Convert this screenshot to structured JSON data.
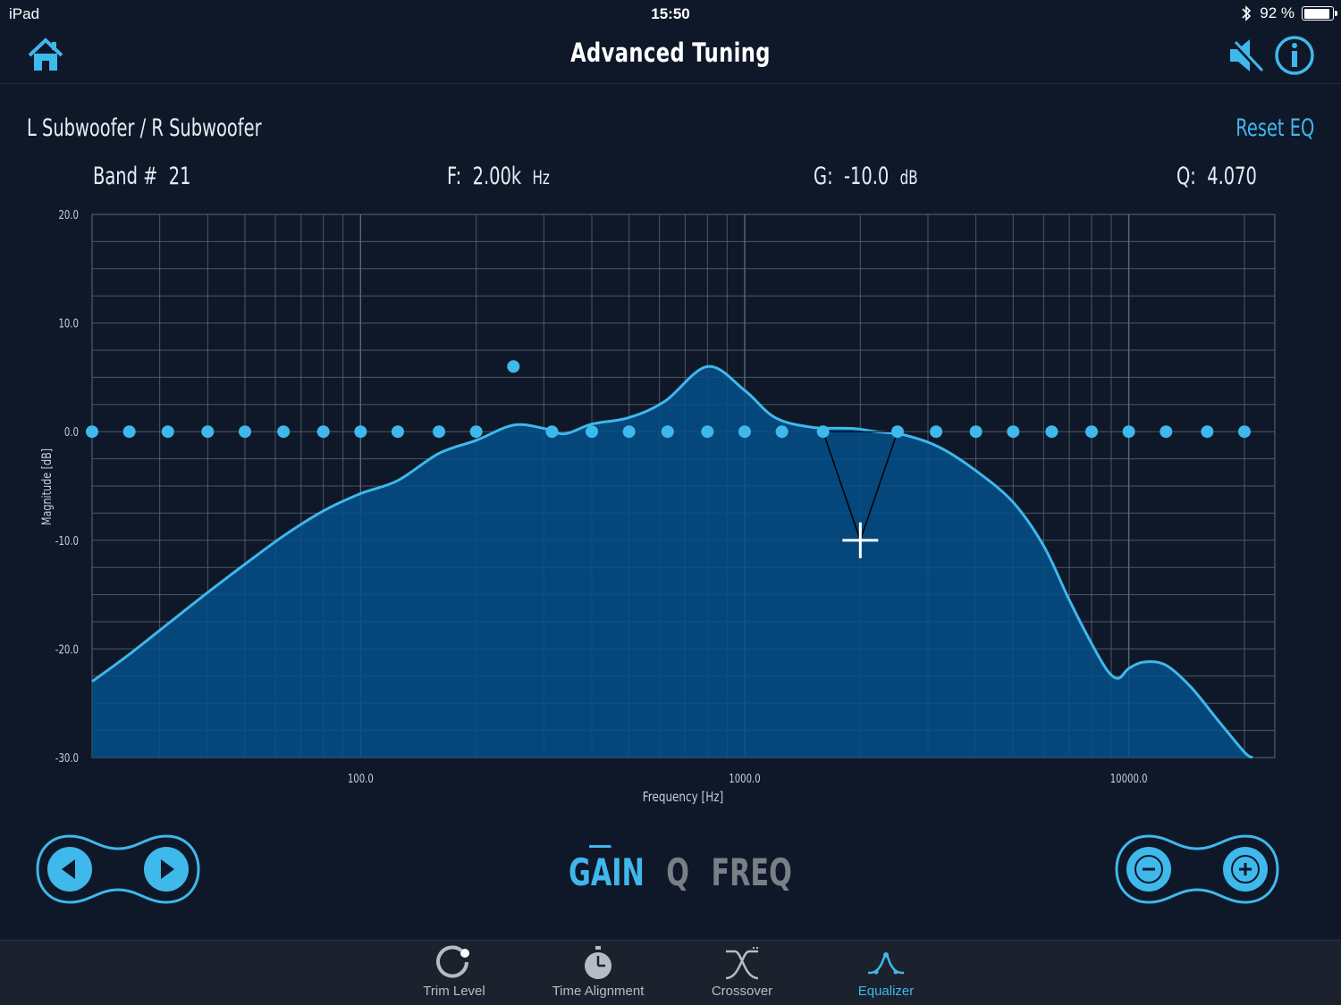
{
  "status": {
    "device": "iPad",
    "time": "15:50",
    "battery": "92 %",
    "battery_level": 0.92
  },
  "nav": {
    "title": "Advanced Tuning",
    "home_icon": "home-icon",
    "speaker_icon": "speaker-mute-icon",
    "info_icon": "info-icon"
  },
  "channel": {
    "label": "L Subwoofer / R Subwoofer",
    "reset_label": "Reset EQ"
  },
  "params": {
    "band_label": "Band #",
    "band_value": "21",
    "freq_label": "F:",
    "freq_value": "2.00k",
    "freq_unit": "Hz",
    "gain_label": "G:",
    "gain_value": "-10.0",
    "gain_unit": "dB",
    "q_label": "Q:",
    "q_value": "4.070"
  },
  "chart_data": {
    "type": "area",
    "xlabel": "Frequency [Hz]",
    "ylabel": "Magnitude [dB]",
    "xscale": "log",
    "xlim": [
      20,
      24000
    ],
    "ylim": [
      -30,
      20
    ],
    "y_ticks": [
      "20.0",
      "10.0",
      "0.0",
      "-10.0",
      "-20.0",
      "-30.0"
    ],
    "y_tick_values": [
      20,
      10,
      0,
      -10,
      -20,
      -30
    ],
    "x_ticks": [
      "100.0",
      "1000.0",
      "10000.0"
    ],
    "x_tick_values": [
      100,
      1000,
      10000
    ],
    "grid": true,
    "response_curve": [
      [
        20,
        -23
      ],
      [
        25,
        -20.5
      ],
      [
        32,
        -17.5
      ],
      [
        40,
        -14.8
      ],
      [
        50,
        -12.2
      ],
      [
        63,
        -9.6
      ],
      [
        80,
        -7.3
      ],
      [
        100,
        -5.7
      ],
      [
        125,
        -4.5
      ],
      [
        160,
        -2.0
      ],
      [
        200,
        -0.8
      ],
      [
        250,
        0.6
      ],
      [
        300,
        0.3
      ],
      [
        340,
        -0.2
      ],
      [
        400,
        0.7
      ],
      [
        500,
        1.3
      ],
      [
        620,
        2.8
      ],
      [
        800,
        6.0
      ],
      [
        1000,
        3.8
      ],
      [
        1200,
        1.3
      ],
      [
        1500,
        0.4
      ],
      [
        1900,
        0.3
      ],
      [
        2200,
        0.0
      ],
      [
        2600,
        -0.3
      ],
      [
        3200,
        -1.4
      ],
      [
        4000,
        -3.6
      ],
      [
        5000,
        -6.5
      ],
      [
        6000,
        -10.5
      ],
      [
        7000,
        -15.5
      ],
      [
        8000,
        -19.5
      ],
      [
        8800,
        -22.0
      ],
      [
        9400,
        -22.7
      ],
      [
        10000,
        -21.8
      ],
      [
        11000,
        -21.2
      ],
      [
        12500,
        -21.5
      ],
      [
        14500,
        -23.5
      ],
      [
        17000,
        -26.5
      ],
      [
        20000,
        -29.5
      ],
      [
        21000,
        -30
      ]
    ],
    "bands": [
      {
        "f": 20,
        "g": 0
      },
      {
        "f": 25,
        "g": 0
      },
      {
        "f": 31.5,
        "g": 0
      },
      {
        "f": 40,
        "g": 0
      },
      {
        "f": 50,
        "g": 0
      },
      {
        "f": 63,
        "g": 0
      },
      {
        "f": 80,
        "g": 0
      },
      {
        "f": 100,
        "g": 0
      },
      {
        "f": 125,
        "g": 0
      },
      {
        "f": 160,
        "g": 0
      },
      {
        "f": 200,
        "g": 0
      },
      {
        "f": 250,
        "g": 6
      },
      {
        "f": 315,
        "g": 0
      },
      {
        "f": 400,
        "g": 0
      },
      {
        "f": 500,
        "g": 0
      },
      {
        "f": 630,
        "g": 0
      },
      {
        "f": 800,
        "g": 0
      },
      {
        "f": 1000,
        "g": 0
      },
      {
        "f": 1250,
        "g": 0
      },
      {
        "f": 1600,
        "g": 0
      },
      {
        "f": 2000,
        "g": -10,
        "selected": true
      },
      {
        "f": 2500,
        "g": 0
      },
      {
        "f": 3150,
        "g": 0
      },
      {
        "f": 4000,
        "g": 0
      },
      {
        "f": 5000,
        "g": 0
      },
      {
        "f": 6300,
        "g": 0
      },
      {
        "f": 8000,
        "g": 0
      },
      {
        "f": 10000,
        "g": 0
      },
      {
        "f": 12500,
        "g": 0
      },
      {
        "f": 16000,
        "g": 0
      },
      {
        "f": 20000,
        "g": 0
      }
    ],
    "selected_band_neighbors": [
      1600,
      2500
    ]
  },
  "controls": {
    "prev_icon": "prev-arrow-icon",
    "next_icon": "next-arrow-icon",
    "minus_icon": "minus-icon",
    "plus_icon": "plus-icon",
    "modes": [
      "GAIN",
      "Q",
      "FREQ"
    ],
    "active_mode": "GAIN"
  },
  "tabs": [
    {
      "label": "Trim Level",
      "icon": "trim-level-icon"
    },
    {
      "label": "Time Alignment",
      "icon": "stopwatch-icon"
    },
    {
      "label": "Crossover",
      "icon": "crossover-icon"
    },
    {
      "label": "Equalizer",
      "icon": "equalizer-icon",
      "active": true
    }
  ],
  "colors": {
    "accent": "#3fb8ec",
    "fill": "#03508a",
    "background": "#0f1829",
    "grid": "#5c6678"
  }
}
